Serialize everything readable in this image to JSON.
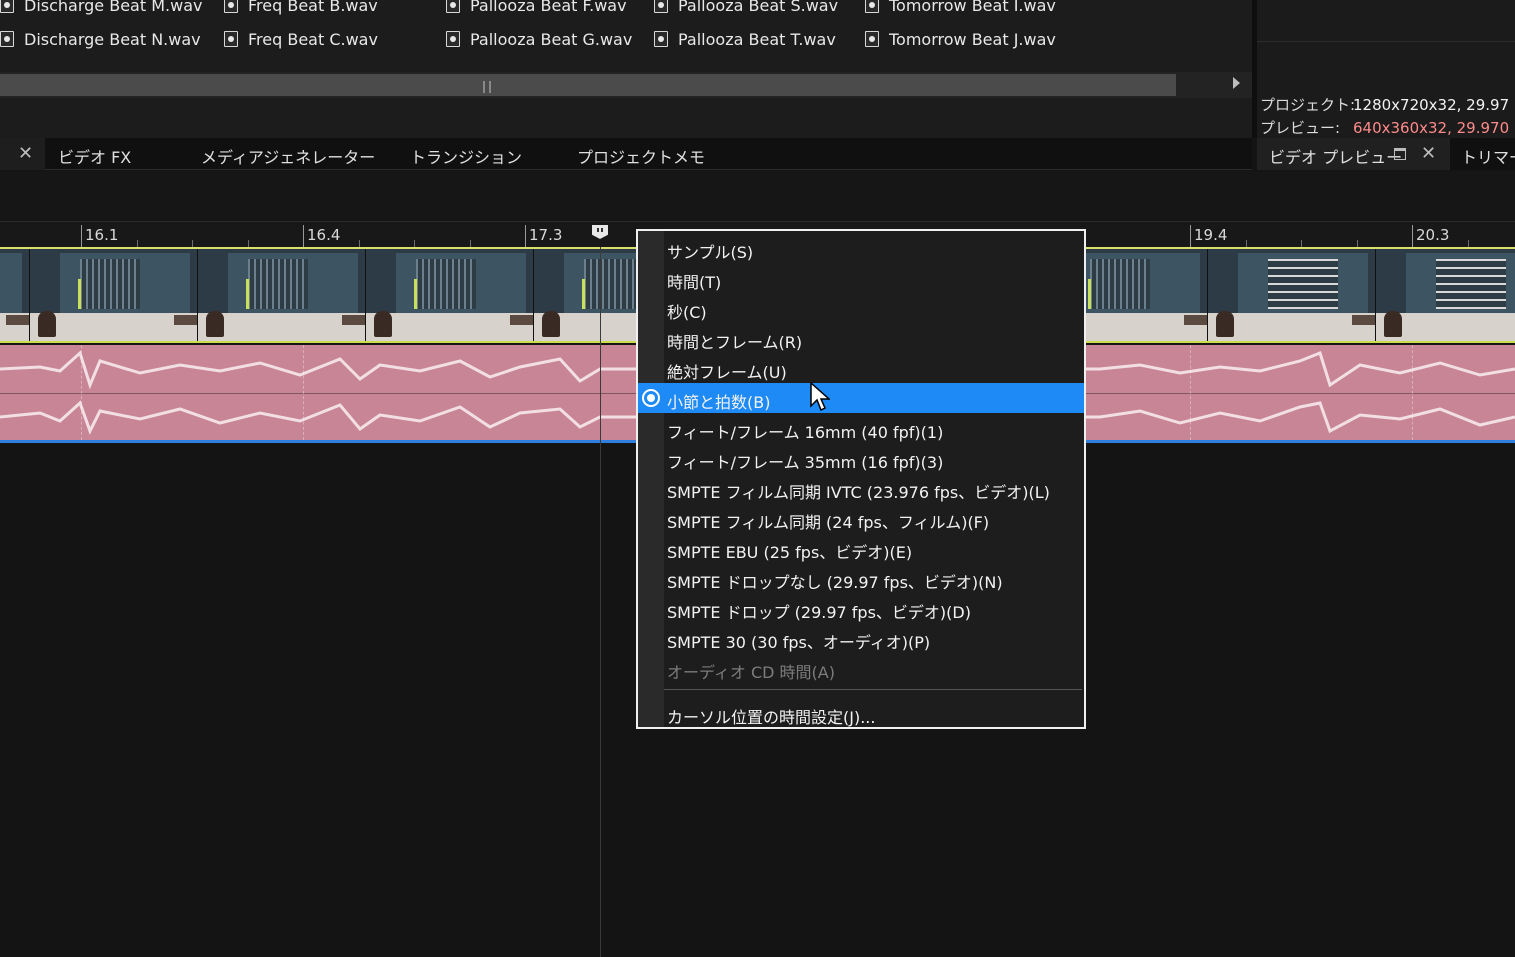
{
  "media_files": [
    [
      "Discharge Beat M.wav",
      "Freq Beat B.wav",
      "Pallooza Beat F.wav",
      "Pallooza Beat S.wav",
      "Tomorrow Beat I.wav"
    ],
    [
      "Discharge Beat N.wav",
      "Freq Beat C.wav",
      "Pallooza Beat G.wav",
      "Pallooza Beat T.wav",
      "Tomorrow Beat J.wav"
    ]
  ],
  "preview_info": {
    "project_label": "プロジェクト:",
    "project_value": "1280x720x32, 29.97",
    "preview_label": "プレビュー:",
    "preview_value": "640x360x32, 29.970"
  },
  "tabs": {
    "close_glyph": "✕",
    "items": [
      "ビデオ FX",
      "メディアジェネレーター",
      "トランジション",
      "プロジェクトメモ"
    ]
  },
  "right_tabs": {
    "video_preview": "ビデオ プレビュー",
    "trimmer": "トリマー"
  },
  "ruler": {
    "labels": [
      "16.1",
      "16.4",
      "17.3",
      "19.4",
      "20.3"
    ]
  },
  "context_menu": {
    "items": [
      {
        "label": "サンプル(S)",
        "state": "normal"
      },
      {
        "label": "時間(T)",
        "state": "normal"
      },
      {
        "label": "秒(C)",
        "state": "normal"
      },
      {
        "label": "時間とフレーム(R)",
        "state": "normal"
      },
      {
        "label": "絶対フレーム(U)",
        "state": "normal"
      },
      {
        "label": "小節と拍数(B)",
        "state": "selected"
      },
      {
        "label": "フィート/フレーム 16mm (40 fpf)(1)",
        "state": "normal"
      },
      {
        "label": "フィート/フレーム 35mm (16 fpf)(3)",
        "state": "normal"
      },
      {
        "label": "SMPTE フィルム同期 IVTC (23.976 fps、ビデオ)(L)",
        "state": "normal"
      },
      {
        "label": "SMPTE フィルム同期 (24 fps、フィルム)(F)",
        "state": "normal"
      },
      {
        "label": "SMPTE EBU (25 fps、ビデオ)(E)",
        "state": "normal"
      },
      {
        "label": "SMPTE ドロップなし (29.97 fps、ビデオ)(N)",
        "state": "normal"
      },
      {
        "label": "SMPTE ドロップ (29.97 fps、ビデオ)(D)",
        "state": "normal"
      },
      {
        "label": "SMPTE 30 (30 fps、オーディオ)(P)",
        "state": "normal"
      },
      {
        "label": "オーディオ CD 時間(A)",
        "state": "disabled"
      }
    ],
    "footer_item": "カーソル位置の時間設定(J)..."
  },
  "colors": {
    "menu_highlight": "#1e8af5",
    "audio_track": "#c88595",
    "preview_value_accent": "#ff8a8a",
    "video_track_edge": "#d9e06a"
  },
  "icons": [
    "audio-file-icon",
    "close-icon",
    "maximize-icon",
    "scroll-right-arrow-icon",
    "radio-selected-icon",
    "mouse-pointer-icon",
    "marker-icon"
  ]
}
